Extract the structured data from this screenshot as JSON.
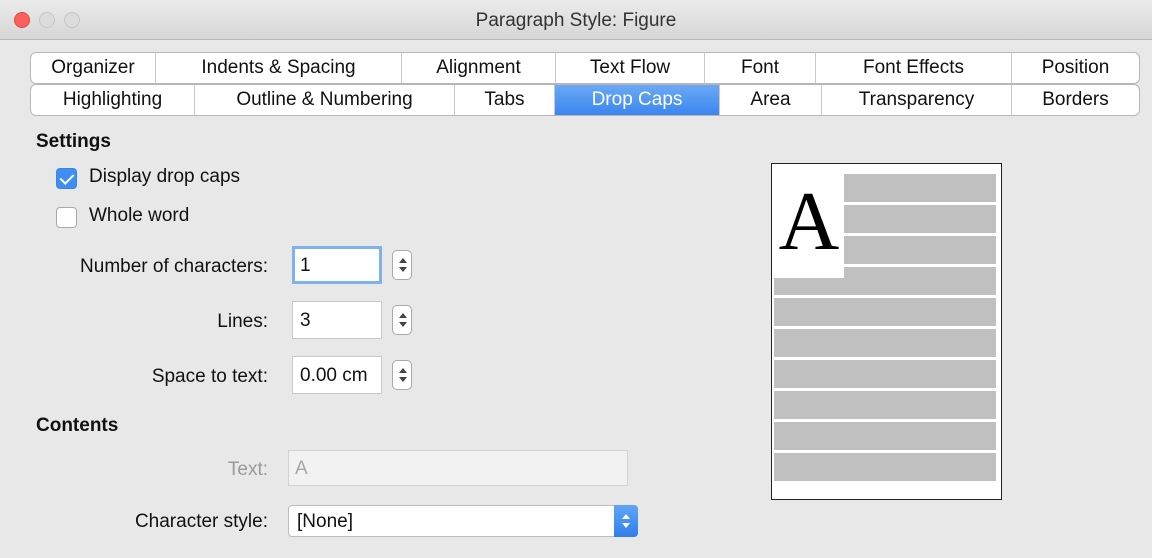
{
  "window": {
    "title": "Paragraph Style: Figure"
  },
  "tabs": {
    "row1": [
      "Organizer",
      "Indents & Spacing",
      "Alignment",
      "Text Flow",
      "Font",
      "Font Effects",
      "Position"
    ],
    "row2": [
      "Highlighting",
      "Outline & Numbering",
      "Tabs",
      "Drop Caps",
      "Area",
      "Transparency",
      "Borders"
    ],
    "active": "Drop Caps"
  },
  "settings": {
    "heading": "Settings",
    "display_drop_caps": {
      "label": "Display drop caps",
      "checked": true
    },
    "whole_word": {
      "label": "Whole word",
      "checked": false
    },
    "number_of_characters": {
      "label": "Number of characters:",
      "value": "1"
    },
    "lines": {
      "label": "Lines:",
      "value": "3"
    },
    "space_to_text": {
      "label": "Space to text:",
      "value": "0.00 cm"
    }
  },
  "contents": {
    "heading": "Contents",
    "text": {
      "label": "Text:",
      "value": "A"
    },
    "character_style": {
      "label": "Character style:",
      "value": "[None]"
    }
  },
  "preview": {
    "drop_cap_letter": "A"
  },
  "colors": {
    "accent": "#3f8ff0",
    "active_tab": "#3a86ef",
    "close_button": "#fc605c",
    "preview_bar": "#c0c0c0"
  }
}
